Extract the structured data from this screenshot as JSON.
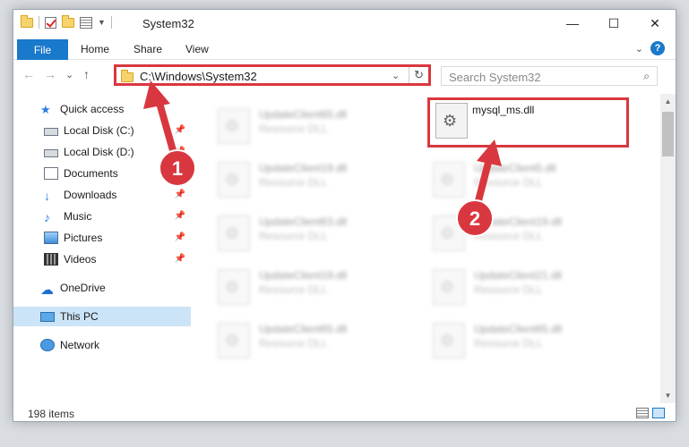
{
  "window": {
    "title": "System32",
    "controls": {
      "minimize": "—",
      "maximize": "☐",
      "close": "✕"
    }
  },
  "ribbon": {
    "tabs": [
      "File",
      "Home",
      "Share",
      "View"
    ],
    "collapse_glyph": "⌄",
    "help_glyph": "?"
  },
  "nav": {
    "back": "←",
    "forward": "→",
    "recent": "⌄",
    "up": "↑",
    "address": "C:\\Windows\\System32",
    "address_dropdown": "⌄",
    "refresh": "↻",
    "search_placeholder": "Search System32",
    "search_icon": "⌕"
  },
  "sidebar": {
    "items": [
      {
        "label": "Quick access",
        "icon": "star-icon"
      },
      {
        "label": "Local Disk (C:)",
        "icon": "drive-icon",
        "pinned": true
      },
      {
        "label": "Local Disk (D:)",
        "icon": "drive-icon",
        "pinned": true
      },
      {
        "label": "Documents",
        "icon": "documents-icon",
        "pinned": true
      },
      {
        "label": "Downloads",
        "icon": "download-icon",
        "pinned": true
      },
      {
        "label": "Music",
        "icon": "music-icon",
        "pinned": true
      },
      {
        "label": "Pictures",
        "icon": "pictures-icon",
        "pinned": true
      },
      {
        "label": "Videos",
        "icon": "videos-icon",
        "pinned": true
      },
      {
        "label": "OneDrive",
        "icon": "cloud-icon"
      },
      {
        "label": "This PC",
        "icon": "computer-icon",
        "selected": true
      },
      {
        "label": "Network",
        "icon": "network-icon"
      }
    ],
    "pin_glyph": "📌"
  },
  "files": [
    {
      "name": "UpdateClient65.dll",
      "type": "Resource DLL"
    },
    {
      "name": "mysql_ms.dll",
      "type": ""
    },
    {
      "name": "UpdateClient19.dll",
      "type": "Resource DLL"
    },
    {
      "name": "UpdateClient5.dll",
      "type": "Resource DLL"
    },
    {
      "name": "UpdateClient63.dll",
      "type": "Resource DLL"
    },
    {
      "name": "UpdateClient19.dll",
      "type": "Resource DLL"
    },
    {
      "name": "UpdateClient19.dll",
      "type": "Resource DLL"
    },
    {
      "name": "UpdateClient21.dll",
      "type": "Resource DLL"
    },
    {
      "name": "UpdateClient65.dll",
      "type": "Resource DLL"
    },
    {
      "name": "UpdateClient65.dll",
      "type": "Resource DLL"
    }
  ],
  "status": {
    "item_count": "198 items"
  },
  "annotations": {
    "badge_1": "1",
    "badge_2": "2",
    "color": "#d9373f"
  }
}
